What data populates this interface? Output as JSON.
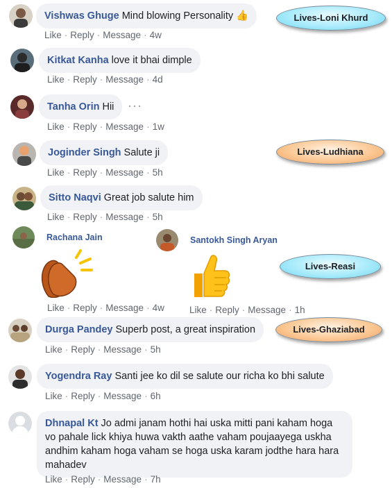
{
  "actions": {
    "like": "Like",
    "reply": "Reply",
    "message": "Message",
    "sep": "·"
  },
  "comments": [
    {
      "name": "Vishwas Ghuge",
      "text": "Mind blowing Personality",
      "emoji": "👍",
      "time": "4w"
    },
    {
      "name": "Kitkat Kanha",
      "text": "love it bhai dimple",
      "time": "4d"
    },
    {
      "name": "Tanha Orin",
      "text": "Hii",
      "more": "···",
      "time": "1w"
    },
    {
      "name": "Joginder Singh",
      "text": "Salute ji",
      "time": "5h"
    },
    {
      "name": "Sitto Naqvi",
      "text": "Great job salute him",
      "time": "5h"
    },
    {
      "name": "Durga Pandey",
      "text": "Superb post, a great inspiration",
      "time": "5h"
    },
    {
      "name": "Yogendra Ray",
      "text": "Santi jee ko dil se salute our richa ko bhi salute",
      "time": "6h"
    },
    {
      "name": "Dhnapal Kt",
      "text": "Jo admi janam hothi hai uska mitti pani kaham hoga vo pahale lick khiya huwa vakth aathe vaham poujaayega uskha andhim kaham hoga vaham se hoga uska karam jodthe hara hara mahadev",
      "time": "7h"
    }
  ],
  "sticker_comments": [
    {
      "name": "Rachana Jain",
      "sticker": "clapping-hands",
      "time": "4w"
    },
    {
      "name": "Santokh Singh Aryan",
      "sticker": "thumbs-up",
      "time": "1h"
    }
  ],
  "tags": [
    {
      "label": "Lives-Loni Khurd",
      "color": "#a9ebfb"
    },
    {
      "label": "Lives-Ludhiana",
      "color": "#fbc996"
    },
    {
      "label": "Lives-Reasi",
      "color": "#a9ebfb"
    },
    {
      "label": "Lives-Ghaziabad",
      "color": "#fbc996"
    }
  ]
}
